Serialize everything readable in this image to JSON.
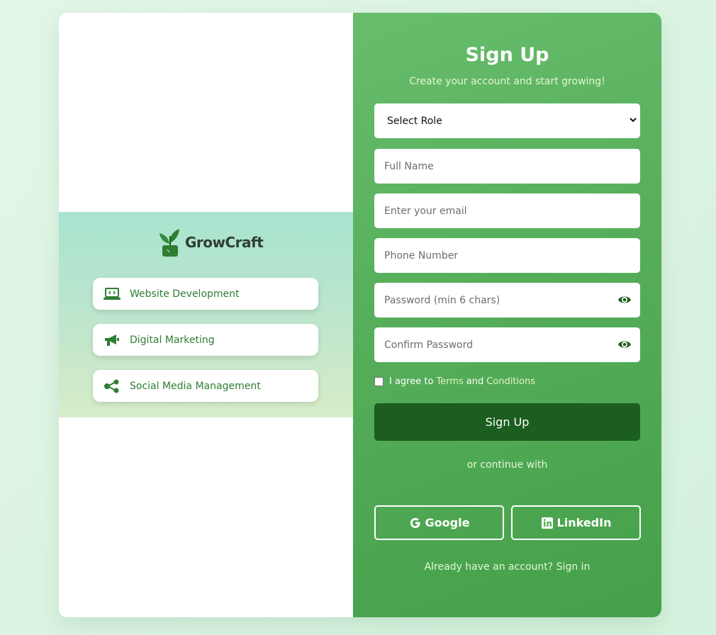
{
  "brand": {
    "name": "GrowCraft"
  },
  "services": [
    {
      "label": "Website Development",
      "icon": "laptop-code-icon"
    },
    {
      "label": "Digital Marketing",
      "icon": "megaphone-icon"
    },
    {
      "label": "Social Media Management",
      "icon": "share-icon"
    }
  ],
  "form": {
    "title": "Sign Up",
    "subtitle": "Create your account and start growing!",
    "role_select": "Select Role",
    "full_name_placeholder": "Full Name",
    "email_placeholder": "Enter your email",
    "phone_placeholder": "Phone Number",
    "password_placeholder": "Password (min 6 chars)",
    "confirm_password_placeholder": "Confirm Password",
    "agree_prefix": "I agree to",
    "terms_link": "Terms",
    "and_word": "and",
    "conditions_link": "Conditions",
    "submit_label": "Sign Up",
    "or_text": "or continue with",
    "google_label": "Google",
    "linkedin_label": "LinkedIn",
    "signin_text": "Already have an account? Sign in"
  },
  "colors": {
    "accent_dark": "#1b5e20",
    "panel_green": "#56ae5a",
    "text_green": "#2e7d32"
  }
}
